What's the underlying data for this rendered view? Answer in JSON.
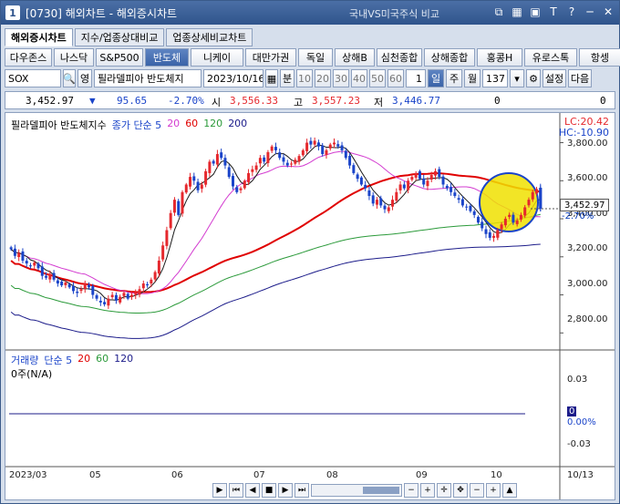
{
  "title": {
    "window_no": "1",
    "text": "[0730] 해외차트 - 해외증시차트",
    "subtitle": "국내VS미국주식 비교",
    "icons": [
      "link-icon",
      "grid-icon",
      "save-icon",
      "font-icon",
      "help-icon",
      "minimize-icon",
      "close-icon"
    ]
  },
  "tabs": [
    {
      "label": "해외증시차트",
      "active": true
    },
    {
      "label": "지수/업종상대비교",
      "active": false
    },
    {
      "label": "업종상세비교차트",
      "active": false
    }
  ],
  "markets": [
    {
      "label": "다우존스"
    },
    {
      "label": "나스닥"
    },
    {
      "label": "S&P500"
    },
    {
      "label": "반도체",
      "active": true
    },
    {
      "label": "니케이"
    },
    {
      "label": "대만가권"
    },
    {
      "label": "독일"
    },
    {
      "label": "상해B"
    },
    {
      "label": "심천종합"
    },
    {
      "label": "상해종합"
    },
    {
      "label": "홍콩H"
    },
    {
      "label": "유로스톡"
    },
    {
      "label": "항셍"
    }
  ],
  "controls": {
    "symbol": "SOX",
    "symbol_type": "영",
    "symbol_name": "필라델피아 반도체지",
    "date": "2023/10/16",
    "period_btn": "분",
    "minute_options": [
      "10",
      "20",
      "30",
      "40",
      "50",
      "60"
    ],
    "count_value": "1",
    "periods": [
      "일",
      "주",
      "월"
    ],
    "active_period": "일",
    "bars": "137",
    "settings": "설정",
    "next": "다음"
  },
  "quote": {
    "price": "3,452.97",
    "change_arrow": "▼",
    "change": "95.65",
    "change_pct": "-2.70%",
    "open_label": "시",
    "open": "3,556.33",
    "high_label": "고",
    "high": "3,557.23",
    "low_label": "저",
    "low": "3,446.77",
    "vol": "0",
    "amount": "0"
  },
  "chart": {
    "legend_name": "필라델피아 반도체지수",
    "legend_ma_label": "종가 단순 5",
    "legend_ma": [
      "20",
      "60",
      "120",
      "200"
    ],
    "lc": "LC:20.42",
    "hc": "HC:-10.90",
    "price_tag": "3,452.97",
    "pct_tag": "-2.70%",
    "y_ticks": [
      "3,800.00",
      "3,600.00",
      "3,400.00",
      "3,200.00",
      "3,000.00",
      "2,800.00"
    ],
    "x_ticks": [
      "2023/03",
      "05",
      "06",
      "07",
      "08",
      "09",
      "10",
      "10/13"
    ],
    "vol_legend_label": "거래량",
    "vol_legend_ma": "단순 5",
    "vol_legend_mas": [
      "20",
      "60",
      "120"
    ],
    "vol_sub": "0주(N/A)",
    "vol_y": [
      "0.03",
      "0",
      "0.00%",
      "-0.03"
    ],
    "colors": {
      "up": "#e5282d",
      "down": "#1a44c9",
      "ma5": "#1a1a1a",
      "ma20": "#d33bd0",
      "ma60": "#e00000",
      "ma120": "#2b9a3a",
      "ma200": "#1c1c8a",
      "highlight": "#f0e000"
    }
  },
  "chart_data": {
    "type": "candlestick",
    "series_name": "필라델피아 반도체지수",
    "x_start": "2023/03",
    "x_end": "10/13",
    "ylim": [
      2720,
      3860
    ],
    "closes": [
      3240,
      3205,
      3220,
      3180,
      3165,
      3150,
      3170,
      3140,
      3100,
      3090,
      3110,
      3080,
      3060,
      3050,
      3065,
      3040,
      3020,
      3010,
      3030,
      3060,
      3040,
      3000,
      2980,
      2960,
      2950,
      2980,
      3000,
      2970,
      2990,
      3010,
      2980,
      3000,
      3010,
      3030,
      3060,
      3050,
      3080,
      3120,
      3180,
      3260,
      3340,
      3430,
      3500,
      3420,
      3540,
      3580,
      3620,
      3600,
      3550,
      3580,
      3650,
      3700,
      3690,
      3740,
      3720,
      3680,
      3620,
      3570,
      3540,
      3560,
      3600,
      3640,
      3660,
      3680,
      3720,
      3700,
      3750,
      3780,
      3760,
      3720,
      3700,
      3680,
      3690,
      3710,
      3730,
      3760,
      3800,
      3790,
      3810,
      3780,
      3740,
      3760,
      3790,
      3800,
      3780,
      3760,
      3720,
      3680,
      3640,
      3610,
      3580,
      3560,
      3520,
      3480,
      3500,
      3470,
      3450,
      3460,
      3500,
      3540,
      3580,
      3560,
      3600,
      3620,
      3640,
      3610,
      3580,
      3600,
      3630,
      3650,
      3620,
      3580,
      3560,
      3540,
      3520,
      3500,
      3470,
      3460,
      3440,
      3420,
      3380,
      3350,
      3320,
      3300,
      3310,
      3340,
      3370,
      3400,
      3420,
      3380,
      3390,
      3420,
      3460,
      3500,
      3540,
      3556,
      3453
    ]
  }
}
